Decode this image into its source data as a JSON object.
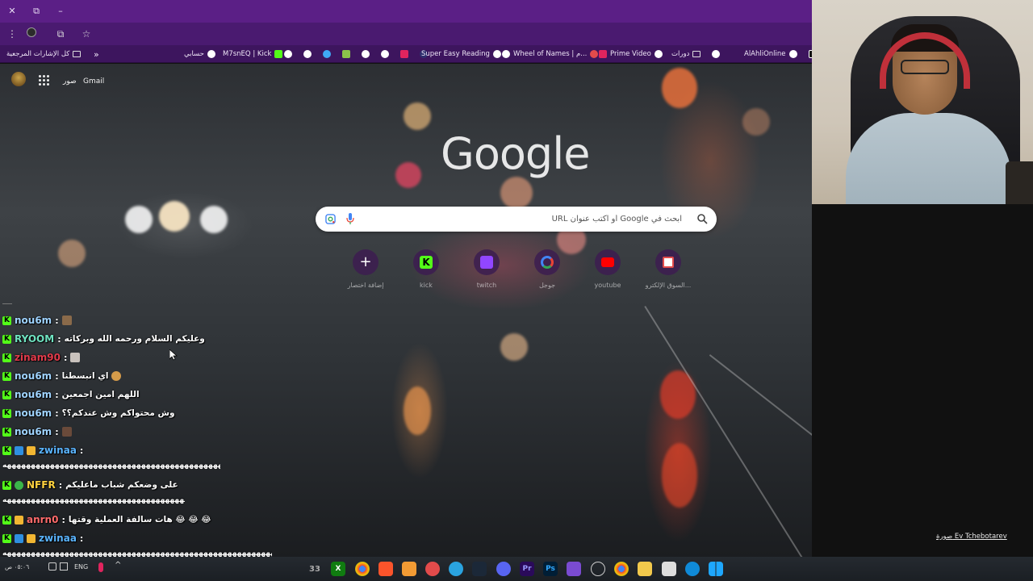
{
  "bookmarks": {
    "all_bookmarks": "كل الإشارات المرجعية",
    "overflow": "»",
    "items": [
      {
        "label": "حسابي",
        "color": "#ffffff"
      },
      {
        "label": "M7snEQ | Kick",
        "color": "#53fc18"
      },
      {
        "label": "Super Easy Reading",
        "color": "#6a5acd"
      },
      {
        "label": "Wheel of Names | م...",
        "color": "#ffffff"
      },
      {
        "label": "Prime Video",
        "color": "#e0245e"
      },
      {
        "label": "دورات",
        "color": "#dddddd"
      },
      {
        "label": "AlAhliOnline",
        "color": "#ffffff"
      }
    ]
  },
  "ntp": {
    "gmail": "Gmail",
    "images": "صور",
    "logo": "Google",
    "search_placeholder": "ابحث في Google أو اكتب عنوان URL",
    "shortcuts": [
      {
        "label": "إضافة اختصار",
        "icon": "plus-icon",
        "color": "#ffffff"
      },
      {
        "label": "kick",
        "icon": "kick-icon",
        "color": "#53fc18"
      },
      {
        "label": "twitch",
        "icon": "twitch-icon",
        "color": "#9146ff"
      },
      {
        "label": "جوجل",
        "icon": "google-icon",
        "color": "#4285f4"
      },
      {
        "label": "youtube",
        "icon": "youtube-icon",
        "color": "#ff0000"
      },
      {
        "label": "السوق الإلكترو...",
        "icon": "store-icon",
        "color": "#e24b4b"
      }
    ],
    "photo_credit": "صورة Ev Tchebotarev"
  },
  "chat": {
    "messages": [
      {
        "user": "nou6m",
        "color": "#9fd3ff",
        "text": "",
        "emote": true
      },
      {
        "user": "RYOOM",
        "color": "#6fe3c1",
        "text": "وعليكم السلام ورحمه الله وبركاته",
        "emote": false
      },
      {
        "user": "zinam90",
        "color": "#e23b4b",
        "text": "",
        "emote": true
      },
      {
        "user": "nou6m",
        "color": "#9fd3ff",
        "text": "اي انبسطنا",
        "emote": true
      },
      {
        "user": "nou6m",
        "color": "#9fd3ff",
        "text": "اللهم امين اجمعين",
        "emote": false
      },
      {
        "user": "nou6m",
        "color": "#9fd3ff",
        "text": "وش محتواكم وش عندكم؟؟",
        "emote": false
      },
      {
        "user": "nou6m",
        "color": "#9fd3ff",
        "text": "",
        "emote": true
      },
      {
        "user": "zwinaa",
        "color": "#5ab4ff",
        "text": "",
        "emote": false
      },
      {
        "user": "NFFR",
        "color": "#ffd23f",
        "text": "على وضعكم شباب ماعليكم",
        "emote": false
      },
      {
        "user": "anrn0",
        "color": "#ff6b6b",
        "text": "هات سالفة العملية وقتها 😂 😂 😂",
        "emote": false
      },
      {
        "user": "zwinaa",
        "color": "#5ab4ff",
        "text": "",
        "emote": false
      }
    ],
    "wrap_lines": [
      "هههههههههههههههههههههههههههههههههههههههههههههههههههههههههههه",
      "ههههههههههههههههههههههههههههههههههههههههههههههههههههههه",
      "هههههههههههههههههههههههههههههههههههههههههههههههههههههههههههههههههههههههه"
    ]
  },
  "taskbar": {
    "lang": "ENG",
    "time": "٠٥:٠٦ ص"
  }
}
